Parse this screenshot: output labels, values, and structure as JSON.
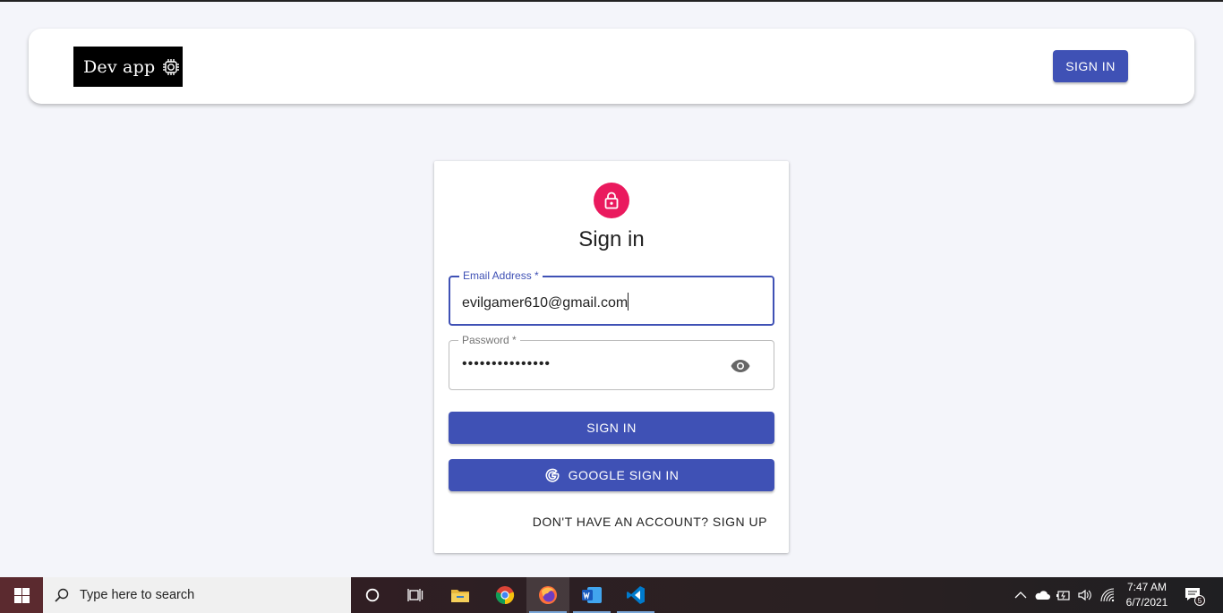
{
  "app": {
    "logo_text": "Dev app",
    "logo_icon": "chip-icon",
    "nav_signin_label": "SIGN IN"
  },
  "card": {
    "avatar_icon": "lock-icon",
    "title": "Sign in",
    "email": {
      "label": "Email Address *",
      "value": "evilgamer610@gmail.com"
    },
    "password": {
      "label": "Password *",
      "value": "•••••••••••••••",
      "toggle_icon": "eye-icon"
    },
    "signin_label": "SIGN IN",
    "google_label": "GOOGLE SIGN IN",
    "google_icon": "google-g-icon",
    "signup_label": "DON'T HAVE AN ACCOUNT? SIGN UP"
  },
  "colors": {
    "primary": "#3f51b5",
    "avatar": "#ea1a5e"
  },
  "taskbar": {
    "search_placeholder": "Type here to search",
    "apps": [
      "cortana-icon",
      "task-view-icon",
      "file-explorer-icon",
      "chrome-icon",
      "firefox-icon",
      "word-icon",
      "vscode-icon"
    ],
    "time": "7:47 AM",
    "date": "6/7/2021",
    "notification_count": "5"
  }
}
